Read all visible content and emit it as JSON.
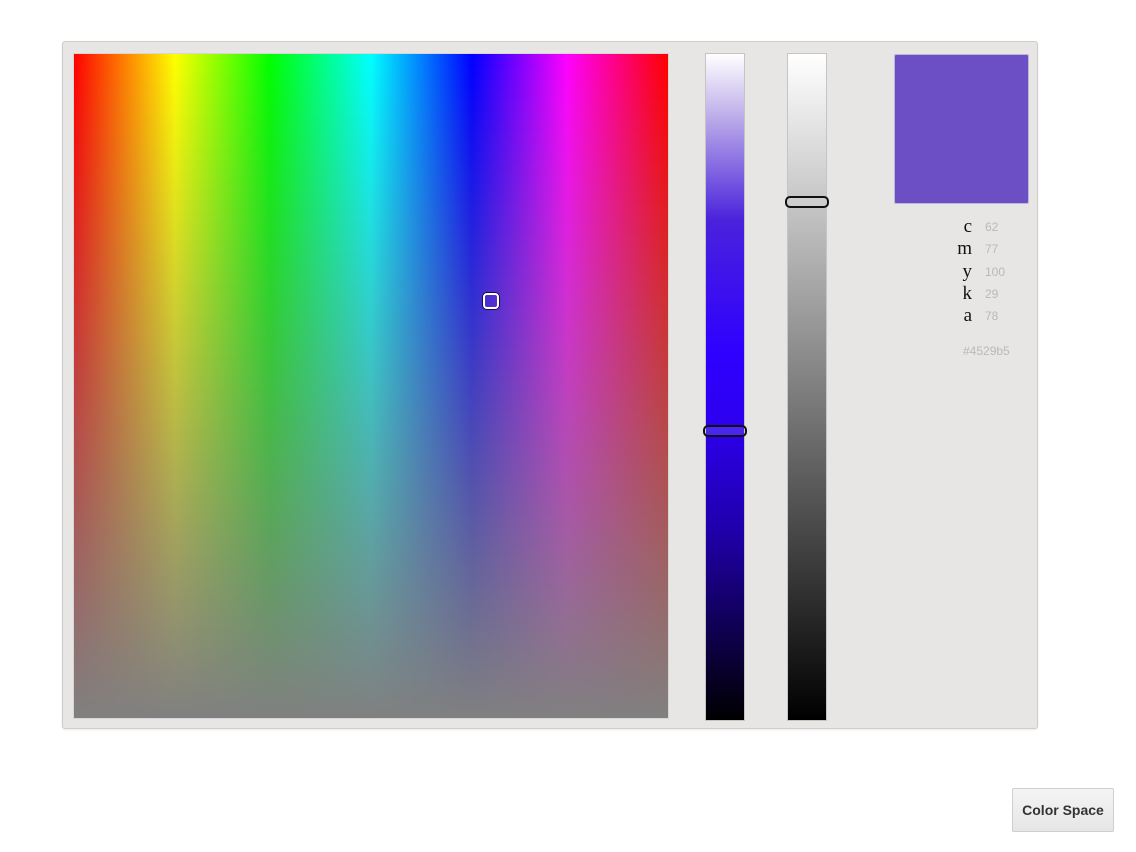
{
  "picker": {
    "field": {
      "cursor_x": 0.7,
      "cursor_y": 0.37
    },
    "hue_slider": {
      "position": 0.565
    },
    "alpha_slider": {
      "position": 0.22
    },
    "swatch_color": "#6c4fc4",
    "values": [
      {
        "label": "c",
        "value": "62"
      },
      {
        "label": "m",
        "value": "77"
      },
      {
        "label": "y",
        "value": "100"
      },
      {
        "label": "k",
        "value": "29"
      },
      {
        "label": "a",
        "value": "78"
      }
    ],
    "hex": "#4529b5"
  },
  "button": {
    "label": "Color Space"
  }
}
